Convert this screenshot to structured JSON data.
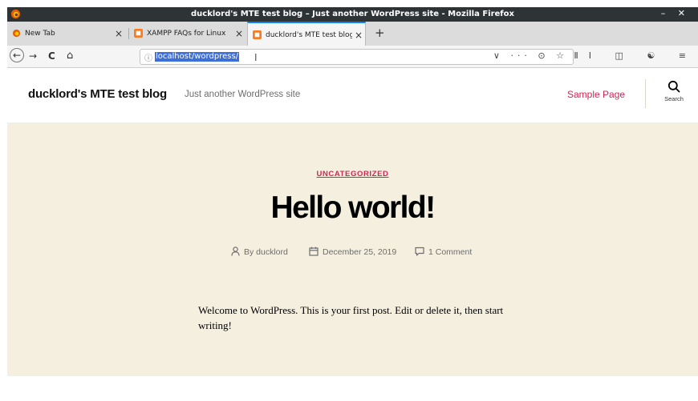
{
  "window": {
    "title": "ducklord's MTE test blog – Just another WordPress site - Mozilla Firefox",
    "controls": "– ✕"
  },
  "tabs": [
    {
      "label": "New Tab",
      "close": "×"
    },
    {
      "label": "XAMPP FAQs for Linux",
      "close": "×"
    },
    {
      "label": "ducklord's MTE test blog",
      "close": "×"
    }
  ],
  "newtab_label": "+",
  "nav": {
    "back": "←",
    "forward": "→",
    "reload": "C",
    "home": "⌂"
  },
  "urlbar": {
    "info": "ⓘ",
    "url": "localhost/wordpress/",
    "cursor": "I",
    "icons": "∨ ··· ⊙ ☆"
  },
  "toolbar_icons": "ⅡⅠ ◫ ☯ ≡",
  "site": {
    "title": "ducklord's MTE test blog",
    "tagline": "Just another WordPress site",
    "menu_item": "Sample Page",
    "search_label": "Search"
  },
  "post": {
    "category": "UNCATEGORIZED",
    "title": "Hello world!",
    "author": "By ducklord",
    "date": "December 25, 2019",
    "comments": "1 Comment",
    "body": "Welcome to WordPress. This is your first post. Edit or delete it, then start writing!"
  },
  "colors": {
    "accent": "#cd2653",
    "hero_bg": "#f5efe0",
    "titlebar": "#2e3436",
    "url_selection": "#3d6fd9"
  }
}
